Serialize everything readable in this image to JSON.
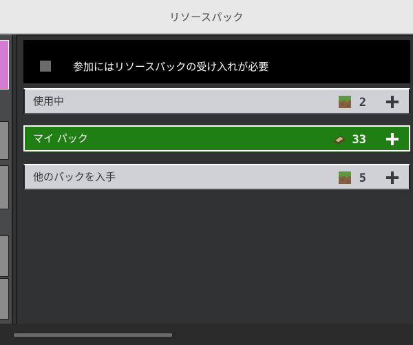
{
  "window": {
    "title": "リソースパック"
  },
  "requirement": {
    "label": "参加にはリソースパックの受け入れが必要"
  },
  "packs": [
    {
      "label": "使用中",
      "count": "2",
      "icon": "grass-block-icon"
    },
    {
      "label": "マイ パック",
      "count": "33",
      "icon": "book-icon"
    },
    {
      "label": "他のパックを入手",
      "count": "5",
      "icon": "grass-block-icon"
    }
  ],
  "colors": {
    "accent_green": "#1f7f12",
    "sidebar_active": "#d57ad3",
    "panel_bg": "#313233"
  }
}
